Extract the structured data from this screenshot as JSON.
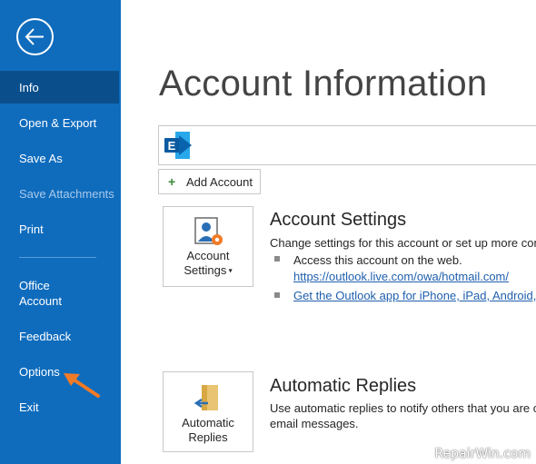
{
  "sidebar": {
    "items": [
      {
        "label": "Info",
        "active": true
      },
      {
        "label": "Open & Export"
      },
      {
        "label": "Save As"
      },
      {
        "label": "Save Attachments",
        "disabled": true
      },
      {
        "label": "Print"
      },
      {
        "label_line1": "Office",
        "label_line2": "Account"
      },
      {
        "label": "Feedback"
      },
      {
        "label": "Options"
      },
      {
        "label": "Exit"
      }
    ]
  },
  "main": {
    "title": "Account Information",
    "add_account_label": "Add Account",
    "account_settings": {
      "tile_line1": "Account",
      "tile_line2": "Settings",
      "title": "Account Settings",
      "description": "Change settings for this account or set up more conne",
      "bullet1": "Access this account on the web.",
      "link1": "https://outlook.live.com/owa/hotmail.com/",
      "link2": "Get the Outlook app for iPhone, iPad, Android, or"
    },
    "automatic_replies": {
      "tile_line1": "Automatic",
      "tile_line2": "Replies",
      "title": "Automatic Replies",
      "description_line1": "Use automatic replies to notify others that you are on",
      "description_line2": "email messages."
    }
  },
  "watermark": "RepairWin.com",
  "colors": {
    "sidebar_bg": "#0f6cbd",
    "sidebar_active": "#0a4f8c",
    "link": "#1f5fad",
    "arrow": "#f07a26"
  }
}
